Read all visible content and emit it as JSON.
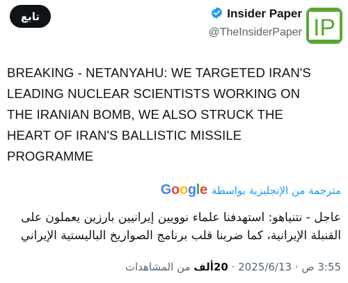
{
  "header": {
    "follow_label": "تابع",
    "display_name": "Insider Paper",
    "handle": "@TheInsiderPaper",
    "avatar_text": "IP"
  },
  "colors": {
    "verified": "#1d9bf0",
    "avatar_bg": "#5aa832",
    "link": "#1d9bf0"
  },
  "tweet": {
    "lines": [
      "BREAKING - NETANYAHU: WE TARGETED IRAN'S",
      "LEADING NUCLEAR SCIENTISTS WORKING ON",
      "THE IRANIAN BOMB, WE ALSO STRUCK THE",
      "HEART OF IRAN'S BALLISTIC MISSILE",
      "PROGRAMME"
    ]
  },
  "translation": {
    "label": "مترجمة من الإنجليزية بواسطة",
    "provider": "Google",
    "lines": [
      "عاجل - نتنياهو: استهدفنا علماء نوويين إيرانيين بارزين يعملون على",
      "القنبلة الإيرانية، كما ضربنا قلب برنامج الصواريخ الباليستية الإيراني"
    ]
  },
  "meta": {
    "time": "3:55 ص",
    "separator": "·",
    "date": "2025/6/13",
    "views_count": "20ألف",
    "views_label": "من المشاهدات"
  }
}
